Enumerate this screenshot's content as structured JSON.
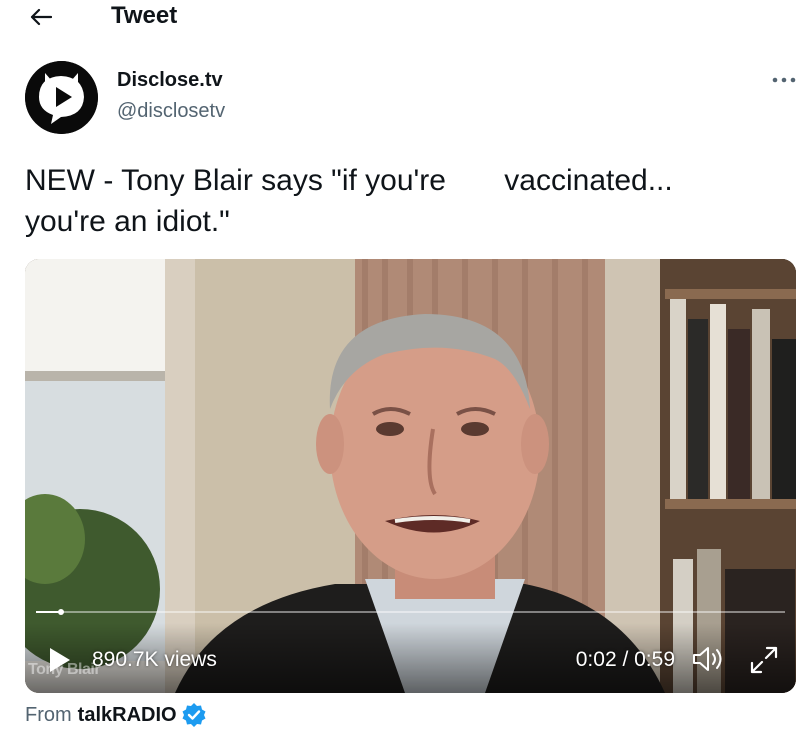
{
  "header": {
    "back_icon": "arrow-left-icon",
    "title": "Tweet"
  },
  "author": {
    "avatar_icon": "play-badge-icon",
    "name": "Disclose.tv",
    "handle": "@disclosetv",
    "more_icon": "more-horizontal-icon"
  },
  "tweet": {
    "text": "NEW - Tony Blair says \"if you're       vaccinated...\nyou're an idiot.\""
  },
  "video": {
    "overlay_caption": "Tony Blair",
    "views": "890.7K views",
    "time": "0:02 / 0:59",
    "progress": 0.034,
    "play_icon": "play-icon",
    "volume_icon": "volume-icon",
    "fullscreen_icon": "fullscreen-icon"
  },
  "source": {
    "prefix": "From",
    "name": "talkRADIO",
    "verified_icon": "verified-badge-icon",
    "verified_color": "#1d9bf0"
  },
  "colors": {
    "text_primary": "#0f1419",
    "text_secondary": "#536471"
  }
}
